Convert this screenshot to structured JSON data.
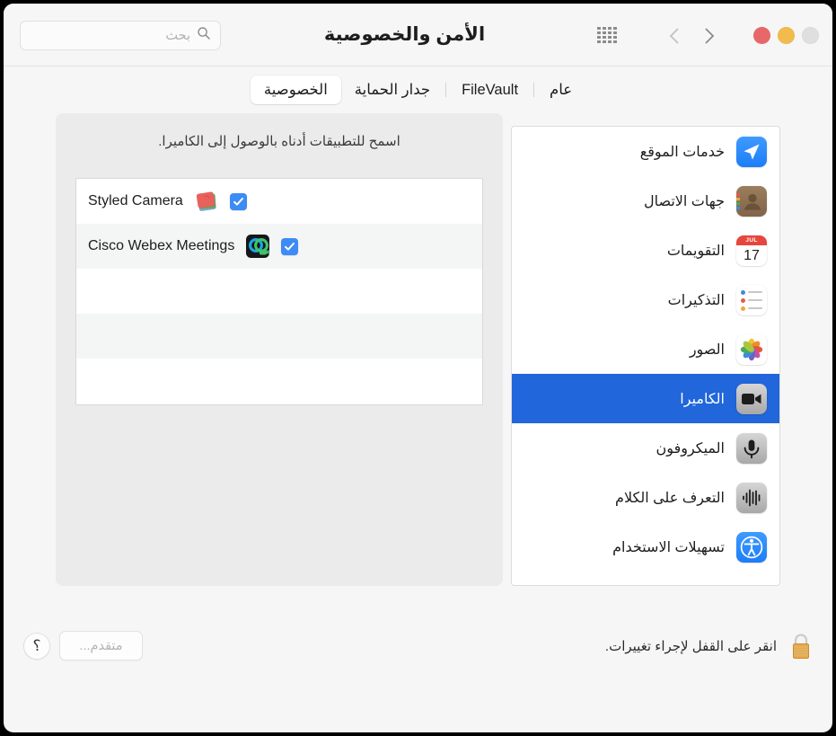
{
  "window": {
    "title": "الأمن والخصوصية",
    "traffic_lights": [
      {
        "name": "maximize",
        "color": "#dfdfdf"
      },
      {
        "name": "minimize",
        "color": "#f2bb4d"
      },
      {
        "name": "close",
        "color": "#e8686a"
      }
    ]
  },
  "toolbar": {
    "grid_icon": "show-all-grid-icon",
    "back_icon": "chevron-back-icon",
    "forward_icon": "chevron-forward-icon"
  },
  "search": {
    "placeholder": "بحث",
    "value": "",
    "icon": "search-icon"
  },
  "tabs": [
    {
      "label": "عام",
      "active": false
    },
    {
      "label": "FileVault",
      "active": false
    },
    {
      "label": "جدار الحماية",
      "active": false
    },
    {
      "label": "الخصوصية",
      "active": true
    }
  ],
  "services": [
    {
      "label": "خدمات الموقع",
      "icon": "location-services-icon",
      "selected": false
    },
    {
      "label": "جهات الاتصال",
      "icon": "contacts-icon",
      "selected": false
    },
    {
      "label": "التقويمات",
      "icon": "calendar-icon",
      "selected": false,
      "calendar_month": "JUL",
      "calendar_day": "17"
    },
    {
      "label": "التذكيرات",
      "icon": "reminders-icon",
      "selected": false
    },
    {
      "label": "الصور",
      "icon": "photos-icon",
      "selected": false
    },
    {
      "label": "الكاميرا",
      "icon": "camera-icon",
      "selected": true
    },
    {
      "label": "الميكروفون",
      "icon": "microphone-icon",
      "selected": false
    },
    {
      "label": "التعرف على الكلام",
      "icon": "speech-recognition-icon",
      "selected": false
    },
    {
      "label": "تسهيلات الاستخدام",
      "icon": "accessibility-icon",
      "selected": false
    }
  ],
  "detail": {
    "description": "اسمح للتطبيقات أدناه بالوصول إلى الكاميرا.",
    "apps": [
      {
        "label": "Styled Camera",
        "checked": true,
        "icon": "styled-camera-app-icon"
      },
      {
        "label": "Cisco Webex Meetings",
        "checked": true,
        "icon": "cisco-webex-app-icon"
      }
    ]
  },
  "bottom": {
    "help_label": "؟",
    "advanced_label": "متقدم...",
    "lock_text": "انقر على القفل لإجراء تغييرات.",
    "lock_icon": "locked-padlock-icon"
  },
  "colors": {
    "selection_blue": "#2166da",
    "checkbox_blue": "#3d8bf5",
    "window_bg": "#f6f6f6",
    "panel_bg": "#ebebeb",
    "row_alt": "#f4f5f5"
  }
}
